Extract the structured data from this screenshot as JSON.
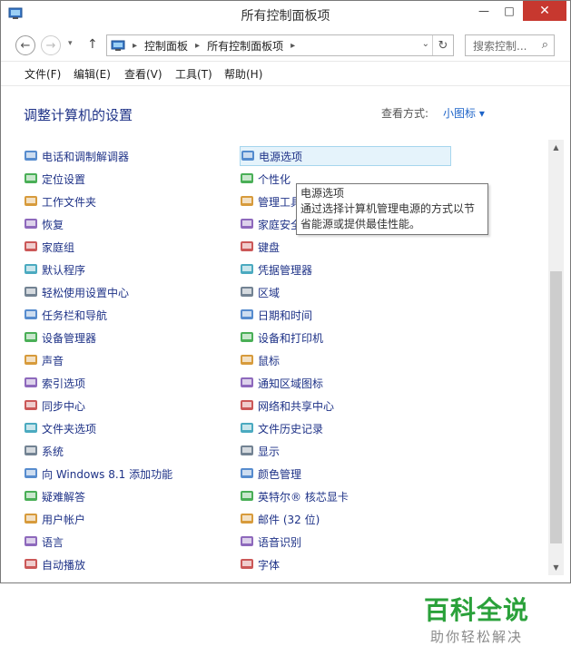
{
  "window": {
    "title": "所有控制面板项",
    "minimize": "—",
    "maximize": "□",
    "close": "✕"
  },
  "nav": {
    "back": "←",
    "forward": "→",
    "recent": "▾",
    "up": "↑",
    "breadcrumbs": [
      "控制面板",
      "所有控制面板项"
    ],
    "crumb_sep": "▸",
    "address_dropdown": "⌄",
    "refresh": "↻",
    "search_placeholder": "搜索控制...",
    "search_icon": "⌕"
  },
  "menu": [
    "文件(F)",
    "编辑(E)",
    "查看(V)",
    "工具(T)",
    "帮助(H)"
  ],
  "content": {
    "heading": "调整计算机的设置",
    "view_by_label": "查看方式:",
    "view_by_value": "小图标 ▾"
  },
  "items_left": [
    "电话和调制解调器",
    "定位设置",
    "工作文件夹",
    "恢复",
    "家庭组",
    "默认程序",
    "轻松使用设置中心",
    "任务栏和导航",
    "设备管理器",
    "声音",
    "索引选项",
    "同步中心",
    "文件夹选项",
    "系统",
    "向 Windows 8.1 添加功能",
    "疑难解答",
    "用户帐户",
    "语言",
    "自动播放"
  ],
  "items_right": [
    "电源选项",
    "个性化",
    "管理工具",
    "家庭安全",
    "键盘",
    "凭据管理器",
    "区域",
    "日期和时间",
    "设备和打印机",
    "鼠标",
    "通知区域图标",
    "网络和共享中心",
    "文件历史记录",
    "显示",
    "颜色管理",
    "英特尔® 核芯显卡",
    "邮件 (32 位)",
    "语音识别",
    "字体"
  ],
  "tooltip": {
    "title": "电源选项",
    "body": "通过选择计算机管理电源的方式以节省能源或提供最佳性能。"
  },
  "watermark": {
    "title": "百科全说",
    "subtitle": "助你轻松解决"
  },
  "colors": {
    "link": "#1e3287",
    "accent": "#1e64c8",
    "close_bg": "#c7382f",
    "watermark": "#2aa13a"
  }
}
